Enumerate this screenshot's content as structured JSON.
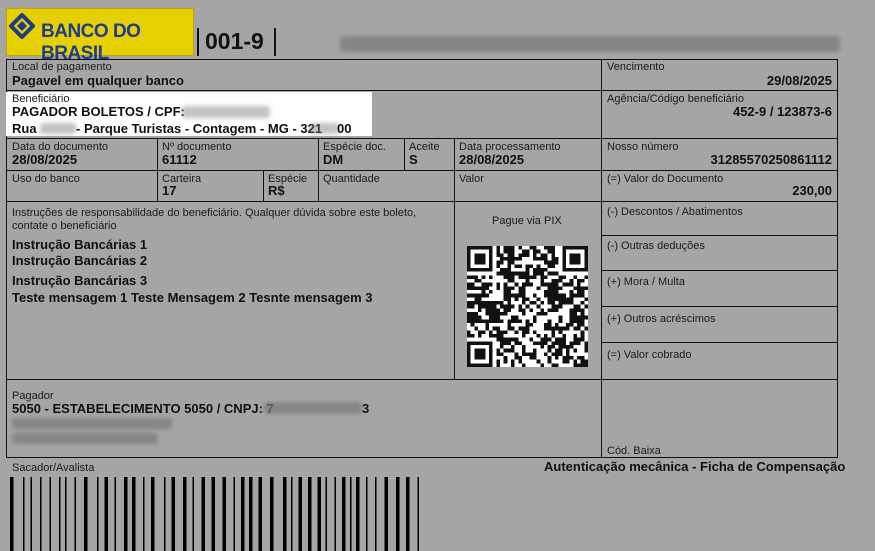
{
  "header": {
    "bank_name": "BANCO DO BRASIL",
    "bank_code": "001-9"
  },
  "fields": {
    "local_pagamento": {
      "label": "Local de pagamento",
      "value": "Pagavel em qualquer banco"
    },
    "vencimento": {
      "label": "Vencimento",
      "value": "29/08/2025"
    },
    "beneficiario": {
      "label": "Beneficiário",
      "line1_prefix": "PAGADOR BOLETOS / CPF:",
      "line2_prefix": "Rua",
      "line2_mid": "- Parque Turistas - Contagem - MG - 321",
      "line2_suffix": "00"
    },
    "agencia": {
      "label": "Agência/Código beneficiário",
      "value": "452-9 / 123873-6"
    },
    "data_documento": {
      "label": "Data do documento",
      "value": "28/08/2025"
    },
    "numero_documento": {
      "label": "Nº documento",
      "value": "61112"
    },
    "especie_doc": {
      "label": "Espécie doc.",
      "value": "DM"
    },
    "aceite": {
      "label": "Aceite",
      "value": "S"
    },
    "data_processamento": {
      "label": "Data processamento",
      "value": "28/08/2025"
    },
    "nosso_numero": {
      "label": "Nosso número",
      "value": "31285570250861112"
    },
    "uso_banco": {
      "label": "Uso do banco"
    },
    "carteira": {
      "label": "Carteira",
      "value": "17"
    },
    "especie": {
      "label": "Espécie",
      "value": "R$"
    },
    "quantidade": {
      "label": "Quantidade"
    },
    "valor": {
      "label": "Valor"
    },
    "valor_documento": {
      "label": "(=) Valor do Documento",
      "value": "230,00"
    }
  },
  "instrucoes": {
    "header_line1": "Instruções de responsabilidade do beneficiário. Qualquer dúvida sobre este boleto,",
    "header_line2": "contate o beneficiário",
    "lines": [
      "Instrução Bancárias 1",
      "Instrução Bancárias 2",
      "Instrução Bancárias 3",
      "Teste mensagem 1 Teste Mensagem 2 Tesnte mensagem 3"
    ]
  },
  "pix": {
    "label": "Pague via PIX"
  },
  "right_column": {
    "descontos": "(-) Descontos / Abatimentos",
    "outras_deducoes": "(-) Outras deduções",
    "mora_multa": "(+) Mora / Multa",
    "outros_acrescimos": "(+) Outros acréscimos",
    "valor_cobrado": "(=) Valor cobrado"
  },
  "pagador": {
    "label": "Pagador",
    "line1_prefix": "5050 - ESTABELECIMENTO 5050 / CNPJ: 7",
    "line1_suffix": "3"
  },
  "cod_baixa": "Cód. Baixa",
  "sacador": "Sacador/Avalista",
  "autenticacao": "Autenticação mecânica - Ficha de Compensação",
  "colors": {
    "background": "#a5a5a5",
    "logo_yellow": "#e7d000",
    "logo_blue": "#1c3c8c",
    "highlight": "#ffffff"
  }
}
